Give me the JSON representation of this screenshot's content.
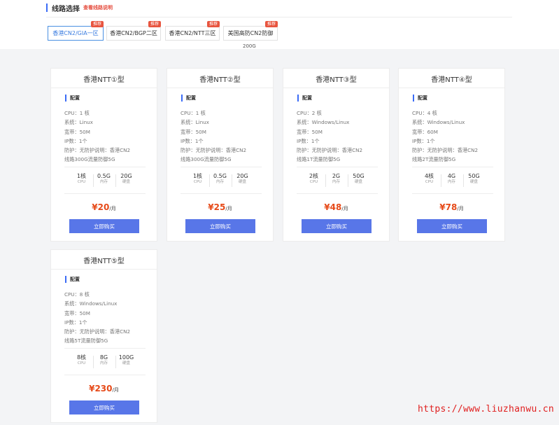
{
  "header": {
    "title": "线路选择",
    "link_text": "查看线路说明"
  },
  "tabs": [
    {
      "label": "香港CN2/GIA一区",
      "badge": "推荐",
      "active": true
    },
    {
      "label": "香港CN2/BGP二区",
      "badge": "推荐",
      "active": false
    },
    {
      "label": "香港CN2/NTT三区",
      "badge": "推荐",
      "active": false
    },
    {
      "label": "美国高防CN2防御",
      "badge": "推荐",
      "active": false
    }
  ],
  "tab_subtext": "200G",
  "config_label": "配置",
  "buy_label": "立即购买",
  "price_unit": "/月",
  "plans": [
    {
      "name": "香港NTT①型",
      "specs": [
        "CPU：1 核",
        "系统：Linux",
        "宽带：50M",
        "IP数：1个",
        "防护：无防护说明：香港CN2",
        "线路300G流量防御5G"
      ],
      "stats": [
        {
          "value": "1核",
          "unit": "CPU"
        },
        {
          "value": "0.5G",
          "unit": "内存"
        },
        {
          "value": "20G",
          "unit": "硬盘"
        }
      ],
      "price": "¥20"
    },
    {
      "name": "香港NTT②型",
      "specs": [
        "CPU：1 核",
        "系统：Linux",
        "宽带：50M",
        "IP数：1个",
        "防护：无防护说明：香港CN2",
        "线路300G流量防御5G"
      ],
      "stats": [
        {
          "value": "1核",
          "unit": "CPU"
        },
        {
          "value": "0.5G",
          "unit": "内存"
        },
        {
          "value": "20G",
          "unit": "硬盘"
        }
      ],
      "price": "¥25"
    },
    {
      "name": "香港NTT③型",
      "specs": [
        "CPU：2 核",
        "系统：Windows/Linux",
        "宽带：50M",
        "IP数：1个",
        "防护：无防护说明：香港CN2",
        "线路1T流量防御5G"
      ],
      "stats": [
        {
          "value": "2核",
          "unit": "CPU"
        },
        {
          "value": "2G",
          "unit": "内存"
        },
        {
          "value": "50G",
          "unit": "硬盘"
        }
      ],
      "price": "¥48"
    },
    {
      "name": "香港NTT④型",
      "specs": [
        "CPU：4 核",
        "系统：Windows/Linux",
        "宽带：60M",
        "IP数：1个",
        "防护：无防护说明：香港CN2",
        "线路2T流量防御5G"
      ],
      "stats": [
        {
          "value": "4核",
          "unit": "CPU"
        },
        {
          "value": "4G",
          "unit": "内存"
        },
        {
          "value": "50G",
          "unit": "硬盘"
        }
      ],
      "price": "¥78"
    },
    {
      "name": "香港NTT⑤型",
      "specs": [
        "CPU：8 核",
        "系统：Windows/Linux",
        "宽带：50M",
        "IP数：1个",
        "防护：无防护说明：香港CN2",
        "线路5T流量防御5G"
      ],
      "stats": [
        {
          "value": "8核",
          "unit": "CPU"
        },
        {
          "value": "8G",
          "unit": "内存"
        },
        {
          "value": "100G",
          "unit": "硬盘"
        }
      ],
      "price": "¥230"
    }
  ],
  "watermark": "https://www.liuzhanwu.cn",
  "colors": {
    "accent": "#5876e8",
    "price": "#e64a19",
    "badge": "#e8553f",
    "active_tab": "#4a90e2"
  }
}
